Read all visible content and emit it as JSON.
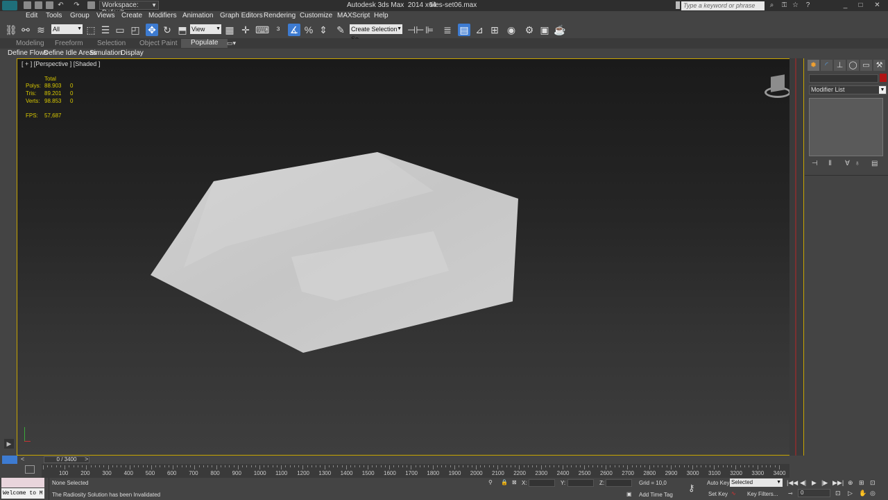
{
  "titlebar": {
    "workspace": "Workspace: Default",
    "app_title": "Autodesk 3ds Max  2014 x64",
    "file_name": "tiles-set06.max",
    "search_placeholder": "Type a keyword or phrase"
  },
  "menu": [
    "Edit",
    "Tools",
    "Group",
    "Views",
    "Create",
    "Modifiers",
    "Animation",
    "Graph Editors",
    "Rendering",
    "Customize",
    "MAXScript",
    "Help"
  ],
  "toolbar": {
    "filter_value": "All",
    "refcoord_value": "View",
    "selection_set_placeholder": "Create Selection Se"
  },
  "ribbon_tabs": [
    "Modeling",
    "Freeform",
    "Selection",
    "Object Paint",
    "Populate"
  ],
  "ribbon_links": [
    "Define Flows",
    "Define Idle Areas",
    "Simulation",
    "Display"
  ],
  "viewport": {
    "label": "[ + ] [Perspective ] [Shaded ]",
    "stats": {
      "header": "Total",
      "rows": [
        {
          "name": "Polys:",
          "total": "88.903",
          "sel": "0"
        },
        {
          "name": "Tris:",
          "total": "89.201",
          "sel": "0"
        },
        {
          "name": "Verts:",
          "total": "98.853",
          "sel": "0"
        }
      ],
      "fps_label": "FPS:",
      "fps_value": "57,687"
    }
  },
  "command_panel": {
    "modifier_list": "Modifier List"
  },
  "timeline": {
    "slider_text": "0 / 3400",
    "ticks": [
      "100",
      "200",
      "300",
      "400",
      "500",
      "600",
      "700",
      "800",
      "900",
      "1000",
      "1100",
      "1200",
      "1300",
      "1400",
      "1500",
      "1600",
      "1700",
      "1800",
      "1900",
      "2000",
      "2100",
      "2200",
      "2300",
      "2400",
      "2500",
      "2600",
      "2700",
      "2800",
      "2900",
      "3000",
      "3100",
      "3200",
      "3300",
      "3400"
    ]
  },
  "status": {
    "welcome": "Welcome to M",
    "selection": "None Selected",
    "prompt": "The Radiosity Solution has been Invalidated",
    "x_label": "X:",
    "y_label": "Y:",
    "z_label": "Z:",
    "grid": "Grid = 10,0",
    "add_time_tag": "Add Time Tag",
    "auto_key": "Auto Key",
    "auto_key_value": "Selected",
    "set_key": "Set Key",
    "key_filters": "Key Filters...",
    "frame_value": "0"
  }
}
